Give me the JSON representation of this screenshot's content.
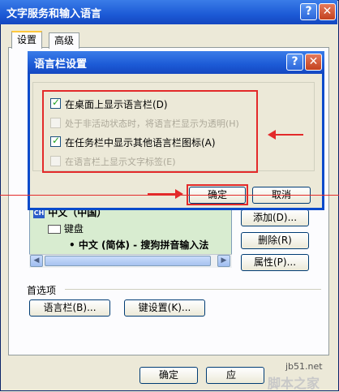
{
  "outer_window": {
    "title": "文字服务和输入语言",
    "help_glyph": "?",
    "close_glyph": "✕",
    "tabs": [
      {
        "label": "设置"
      },
      {
        "label": "高级"
      }
    ],
    "language_list": {
      "rows": [
        {
          "text": "中文（中国）"
        },
        {
          "text": "键盘"
        },
        {
          "text": "• 中文 (简体) - 搜狗拼音输入法"
        }
      ]
    },
    "side_buttons": {
      "add": "添加(D)...",
      "remove": "删除(R)",
      "properties": "属性(P)..."
    },
    "preferences": {
      "label": "首选项",
      "language_bar_button": "语言栏(B)...",
      "key_settings_button": "键设置(K)..."
    },
    "bottom_buttons": {
      "ok": "确定",
      "apply": "应"
    },
    "watermark": {
      "site": "jb51.net",
      "name": "脚本之家"
    }
  },
  "dialog": {
    "title": "语言栏设置",
    "help_glyph": "?",
    "close_glyph": "✕",
    "options": [
      {
        "label": "在桌面上显示语言栏(D)",
        "checked": true,
        "enabled": true
      },
      {
        "label": "处于非活动状态时，将语言栏显示为透明(H)",
        "checked": false,
        "enabled": false
      },
      {
        "label": "在任务栏中显示其他语言栏图标(A)",
        "checked": true,
        "enabled": true
      },
      {
        "label": "在语言栏上显示文字标签(E)",
        "checked": false,
        "enabled": false
      }
    ],
    "ok_button": "确定",
    "cancel_button": "取消"
  },
  "annotation_color": "#e32a2a"
}
